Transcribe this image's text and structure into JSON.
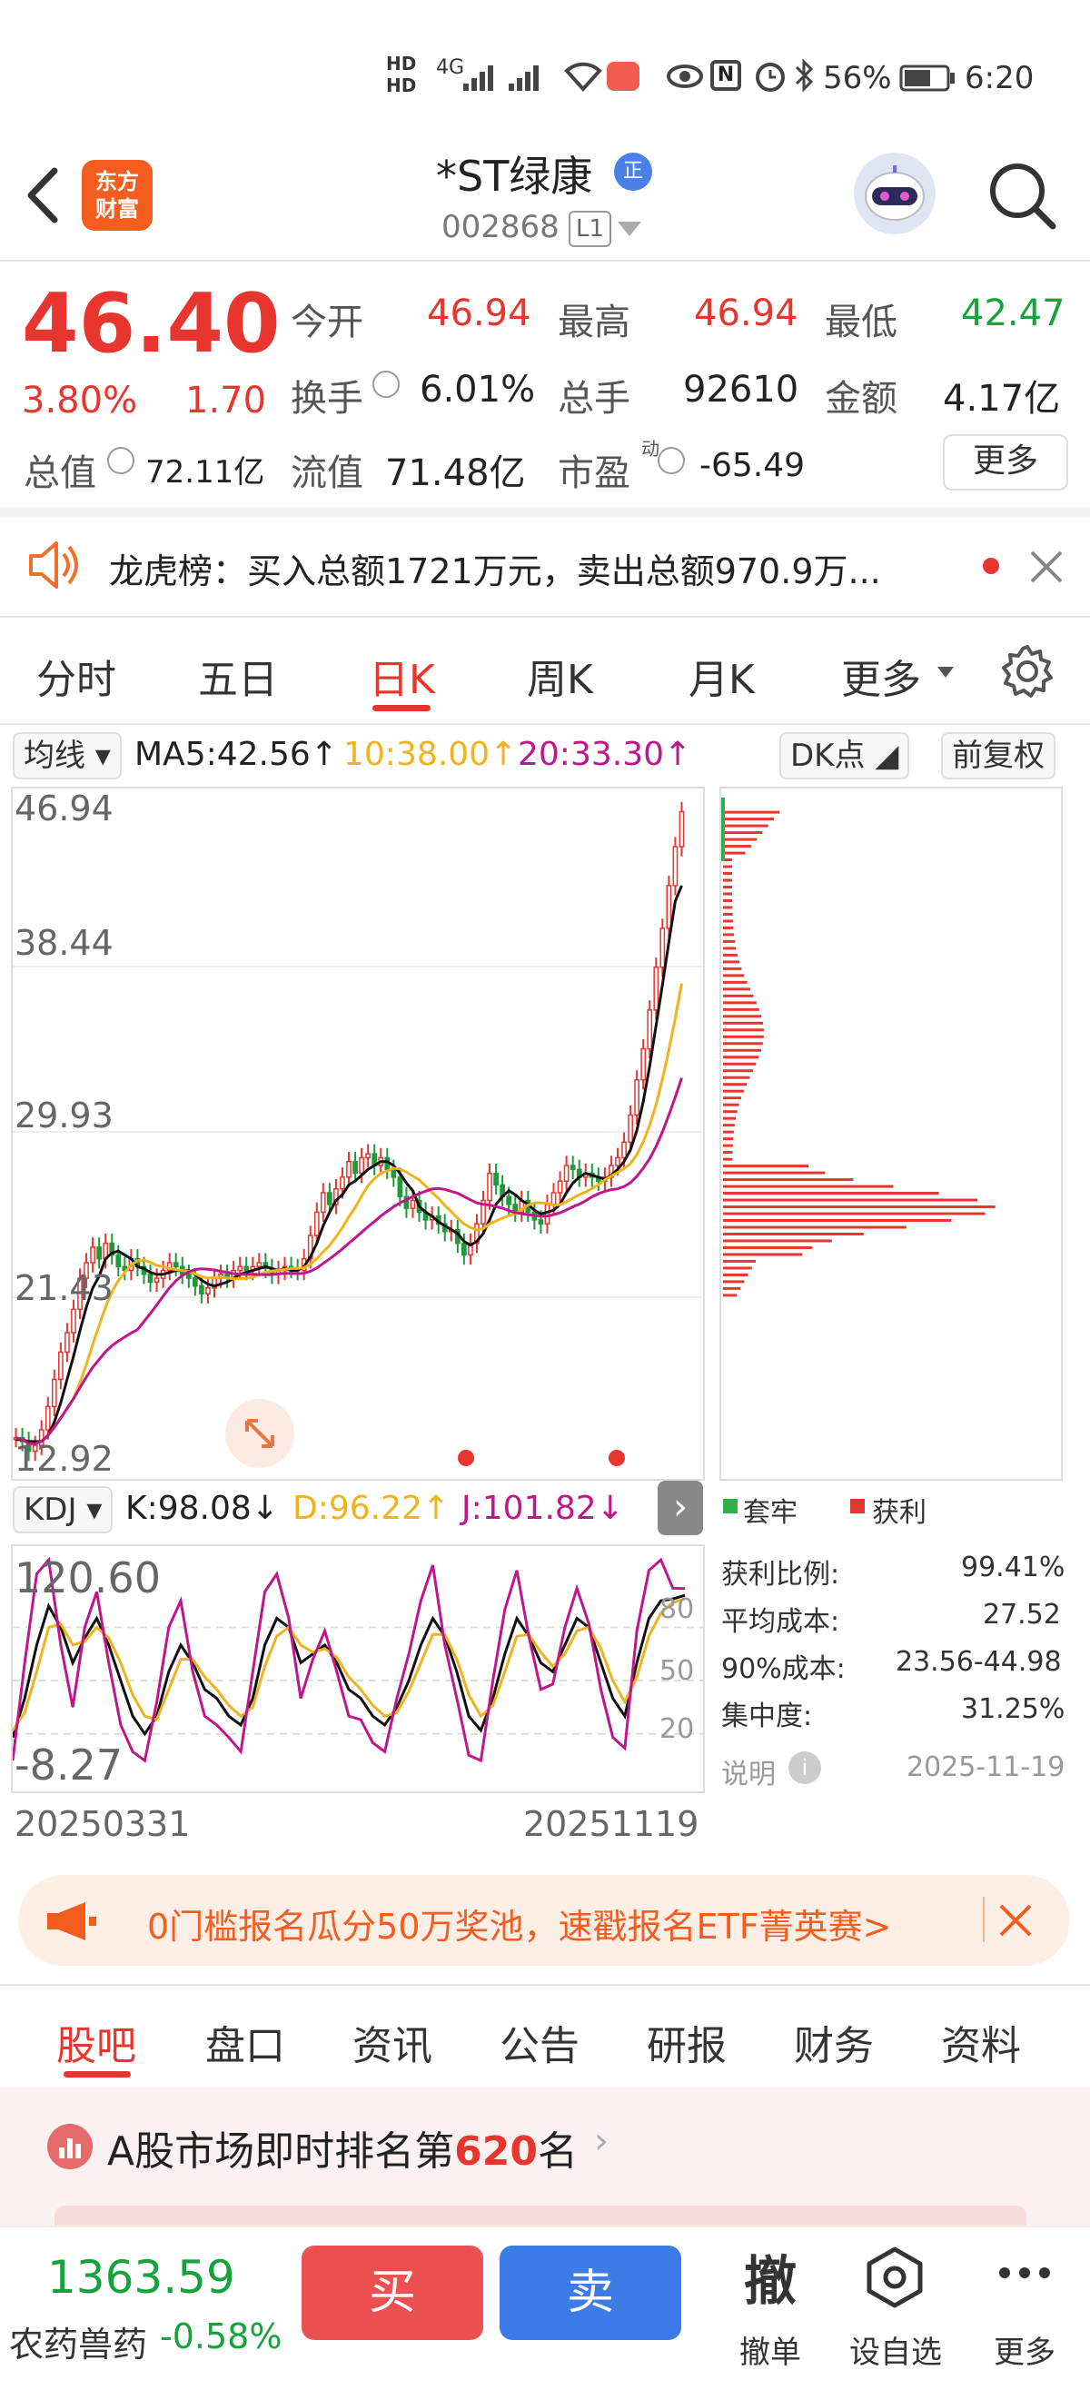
{
  "status_bar": {
    "network": "4G",
    "battery": "56%",
    "time": "6:20"
  },
  "header": {
    "back_icon": "chevron-left-icon",
    "app_logo_text": "东方\n财富",
    "title": "*ST绿康",
    "verified_badge": "正",
    "code": "002868",
    "level": "L1"
  },
  "quote": {
    "price": "46.40",
    "change_pct": "3.80%",
    "change": "1.70",
    "open_label": "今开",
    "open": "46.94",
    "high_label": "最高",
    "high": "46.94",
    "low_label": "最低",
    "low": "42.47",
    "turnover_label": "换手",
    "turnover": "6.01%",
    "volume_label": "总手",
    "volume": "92610",
    "amount_label": "金额",
    "amount": "4.17亿",
    "mktcap_label": "总值",
    "mktcap": "72.11亿",
    "float_label": "流值",
    "float_cap": "71.48亿",
    "pe_label": "市盈",
    "pe_sup": "动",
    "pe": "-65.49",
    "more_button": "更多"
  },
  "notice": {
    "text": "龙虎榜：买入总额1721万元，卖出总额970.9万..."
  },
  "chart_tabs": {
    "items": [
      "分时",
      "五日",
      "日K",
      "周K",
      "月K",
      "更多"
    ],
    "active": "日K"
  },
  "indicator_bar": {
    "ma_select": "均线",
    "ma5": "MA5:42.56",
    "ma10": "10:38.00",
    "ma20": "20:33.30",
    "dk_button": "DK点",
    "adjust_button": "前复权"
  },
  "kdj_bar": {
    "select": "KDJ",
    "k": "K:98.08",
    "d": "D:96.22",
    "j": "J:101.82"
  },
  "chart_data": [
    {
      "type": "candlestick",
      "name": "日K",
      "y_ticks": [
        "46.94",
        "38.44",
        "29.93",
        "21.43",
        "12.92"
      ],
      "ylim": [
        12.92,
        46.94
      ],
      "x_start": "20250331",
      "x_end": "20251119",
      "close": [
        14.2,
        14.0,
        13.5,
        13.8,
        14.6,
        15.8,
        17.2,
        18.6,
        19.6,
        20.8,
        22.4,
        23.2,
        24.0,
        23.4,
        24.2,
        23.6,
        23.0,
        22.8,
        23.4,
        23.0,
        22.6,
        22.2,
        22.4,
        22.8,
        23.2,
        23.0,
        22.6,
        22.4,
        22.0,
        21.6,
        21.9,
        22.4,
        22.6,
        22.4,
        22.8,
        23.0,
        22.8,
        23.0,
        23.2,
        22.9,
        22.6,
        22.8,
        23.0,
        22.9,
        22.8,
        23.4,
        24.6,
        25.8,
        26.8,
        26.2,
        27.0,
        27.6,
        28.4,
        27.8,
        28.6,
        28.8,
        28.2,
        28.6,
        28.0,
        27.6,
        26.6,
        26.0,
        26.4,
        25.8,
        25.4,
        25.6,
        25.2,
        24.8,
        24.9,
        24.2,
        23.6,
        24.2,
        25.2,
        26.4,
        27.8,
        27.2,
        26.6,
        26.2,
        25.8,
        26.4,
        25.8,
        25.4,
        25.2,
        26.2,
        26.8,
        27.4,
        28.2,
        28.0,
        27.6,
        27.8,
        27.6,
        27.4,
        27.6,
        28.2,
        28.6,
        29.4,
        30.8,
        32.6,
        34.2,
        36.2,
        38.4,
        40.4,
        42.6,
        44.6,
        46.4
      ],
      "ma5": [
        14.1,
        14.1,
        14.0,
        14.0,
        14.0,
        14.3,
        15.0,
        16.0,
        17.2,
        18.4,
        19.7,
        20.9,
        21.9,
        22.5,
        23.4,
        23.7,
        23.8,
        23.6,
        23.4,
        23.0,
        22.9,
        22.7,
        22.6,
        22.6,
        22.7,
        22.8,
        22.8,
        22.8,
        22.6,
        22.3,
        22.1,
        22.0,
        22.1,
        22.2,
        22.4,
        22.6,
        22.7,
        22.8,
        22.9,
        23.0,
        22.9,
        22.8,
        22.9,
        22.8,
        22.8,
        23.0,
        23.5,
        24.2,
        25.1,
        25.8,
        26.4,
        26.7,
        27.2,
        27.4,
        27.7,
        28.0,
        28.2,
        28.4,
        28.4,
        28.2,
        27.8,
        27.3,
        26.9,
        26.1,
        25.8,
        25.6,
        25.3,
        25.1,
        24.9,
        24.7,
        24.3,
        24.1,
        24.3,
        24.7,
        25.4,
        26.2,
        26.6,
        26.9,
        26.7,
        26.4,
        26.2,
        25.9,
        25.7,
        25.8,
        25.9,
        26.2,
        26.8,
        27.3,
        27.6,
        27.8,
        27.7,
        27.6,
        27.5,
        27.7,
        28.0,
        28.4,
        29.0,
        30.0,
        31.5,
        33.3,
        35.4,
        37.5,
        39.7,
        41.8,
        42.6
      ],
      "ma10_value": 38.0,
      "ma20_value": 33.3
    },
    {
      "type": "line",
      "name": "KDJ",
      "y_ticks": [
        "120.60",
        "80",
        "50",
        "20",
        "-8.27"
      ],
      "ylim": [
        -8.27,
        120.6
      ],
      "series": [
        {
          "name": "K",
          "values": [
            18,
            40,
            70,
            92,
            80,
            60,
            74,
            85,
            70,
            50,
            30,
            20,
            30,
            55,
            70,
            60,
            45,
            40,
            30,
            25,
            40,
            70,
            85,
            80,
            60,
            65,
            70,
            60,
            45,
            40,
            30,
            25,
            35,
            50,
            70,
            85,
            75,
            55,
            30,
            22,
            40,
            65,
            85,
            75,
            60,
            55,
            70,
            85,
            80,
            60,
            40,
            30,
            60,
            85,
            95,
            96,
            98
          ]
        },
        {
          "name": "D",
          "values": [
            22,
            32,
            55,
            80,
            82,
            70,
            72,
            80,
            74,
            60,
            42,
            30,
            28,
            45,
            62,
            62,
            52,
            45,
            36,
            30,
            35,
            58,
            75,
            80,
            70,
            66,
            68,
            63,
            52,
            45,
            36,
            30,
            32,
            44,
            60,
            76,
            76,
            62,
            42,
            30,
            36,
            55,
            75,
            76,
            66,
            58,
            65,
            78,
            80,
            68,
            50,
            38,
            52,
            75,
            88,
            94,
            96
          ]
        },
        {
          "name": "J",
          "values": [
            5,
            60,
            110,
            118,
            70,
            35,
            80,
            100,
            60,
            25,
            10,
            5,
            38,
            80,
            95,
            55,
            30,
            25,
            18,
            10,
            55,
            100,
            110,
            85,
            40,
            62,
            78,
            55,
            30,
            28,
            15,
            10,
            40,
            65,
            95,
            115,
            70,
            40,
            8,
            5,
            50,
            90,
            112,
            75,
            45,
            48,
            80,
            102,
            82,
            45,
            18,
            12,
            78,
            112,
            118,
            102,
            101.82
          ]
        }
      ]
    },
    {
      "type": "bar",
      "name": "筹码分布",
      "legend": [
        "套牢",
        "获利"
      ]
    }
  ],
  "chip_stats": {
    "legend_trapped": "套牢",
    "legend_profit": "获利",
    "profit_ratio_label": "获利比例:",
    "profit_ratio": "99.41%",
    "avg_cost_label": "平均成本:",
    "avg_cost": "27.52",
    "cost90_label": "90%成本:",
    "cost90": "23.56-44.98",
    "concentration_label": "集中度:",
    "concentration": "31.25%",
    "explain_label": "说明",
    "date": "2025-11-19"
  },
  "banner": {
    "text": "0门槛报名瓜分50万奖池，速戳报名ETF菁英赛>"
  },
  "bottom_tabs": {
    "items": [
      "股吧",
      "盘口",
      "资讯",
      "公告",
      "研报",
      "财务",
      "资料"
    ],
    "active": "股吧"
  },
  "ranking": {
    "prefix": "A股市场即时排名第",
    "rank": "620",
    "suffix": "名"
  },
  "toolbar": {
    "index_value": "1363.59",
    "index_name": "农药兽药",
    "index_change": "-0.58%",
    "buy": "买",
    "sell": "卖",
    "cancel_big": "撤",
    "cancel": "撤单",
    "alert": "设自选",
    "more": "更多"
  }
}
